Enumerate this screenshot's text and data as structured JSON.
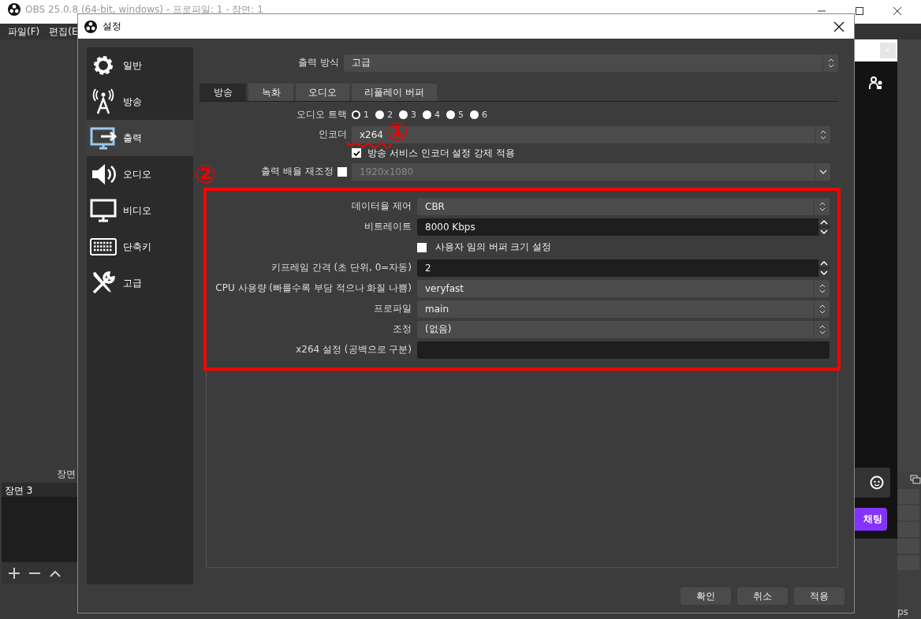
{
  "main_window": {
    "title": "OBS 25.0.8 (64-bit, windows) - 프로파일: 1 - 장면: 1",
    "menu": [
      "파일(F)",
      "편집(E"
    ],
    "scenes_dock": {
      "title": "장면",
      "items": [
        {
          "label": "장면 3",
          "selected": true
        }
      ]
    },
    "chat_dock": {
      "send_button": "채팅"
    },
    "status_text": "ps"
  },
  "dialog": {
    "title": "설정",
    "sidebar": [
      {
        "label": "일반",
        "selected": false
      },
      {
        "label": "방송",
        "selected": false
      },
      {
        "label": "출력",
        "selected": true
      },
      {
        "label": "오디오",
        "selected": false
      },
      {
        "label": "비디오",
        "selected": false
      },
      {
        "label": "단축키",
        "selected": false
      },
      {
        "label": "고급",
        "selected": false
      }
    ],
    "output_mode": {
      "label": "출력 방식",
      "value": "고급"
    },
    "tabs": [
      {
        "label": "방송",
        "selected": true
      },
      {
        "label": "녹화",
        "selected": false
      },
      {
        "label": "오디오",
        "selected": false
      },
      {
        "label": "리플레이 버퍼",
        "selected": false
      }
    ],
    "audio_track": {
      "label": "오디오 트랙",
      "options": [
        {
          "label": "1",
          "selected": true
        },
        {
          "label": "2",
          "selected": false
        },
        {
          "label": "3",
          "selected": false
        },
        {
          "label": "4",
          "selected": false
        },
        {
          "label": "5",
          "selected": false
        },
        {
          "label": "6",
          "selected": false
        }
      ]
    },
    "encoder": {
      "label": "인코더",
      "value": "x264"
    },
    "enforce": {
      "label": "방송 서비스 인코더 설정 강제 적용",
      "checked": true
    },
    "rescale": {
      "label": "출력 배율 재조정",
      "checked": false,
      "value": "1920x1080",
      "disabled": true
    },
    "encoder_settings": [
      {
        "kind": "combo",
        "label": "데이터율 제어",
        "value": "CBR"
      },
      {
        "kind": "spin",
        "label": "비트레이트",
        "value": "8000 Kbps"
      },
      {
        "kind": "check",
        "label": "사용자 임의 버퍼 크기 설정",
        "checked": false
      },
      {
        "kind": "spin",
        "label": "키프레임 간격 (초 단위, 0=자동)",
        "value": "2"
      },
      {
        "kind": "combo",
        "label": "CPU 사용량 (빠를수록 부담 적으나 화질 나쁨)",
        "value": "veryfast"
      },
      {
        "kind": "combo",
        "label": "프로파일",
        "value": "main"
      },
      {
        "kind": "combo",
        "label": "조정",
        "value": "(없음)"
      },
      {
        "kind": "text",
        "label": "x264 설정 (공백으로 구분)"
      }
    ],
    "buttons": [
      "확인",
      "취소",
      "적용"
    ]
  },
  "annotations": [
    {
      "kind": "number",
      "text": "①"
    },
    {
      "kind": "number",
      "text": "②"
    },
    {
      "kind": "box"
    },
    {
      "kind": "underline"
    }
  ]
}
